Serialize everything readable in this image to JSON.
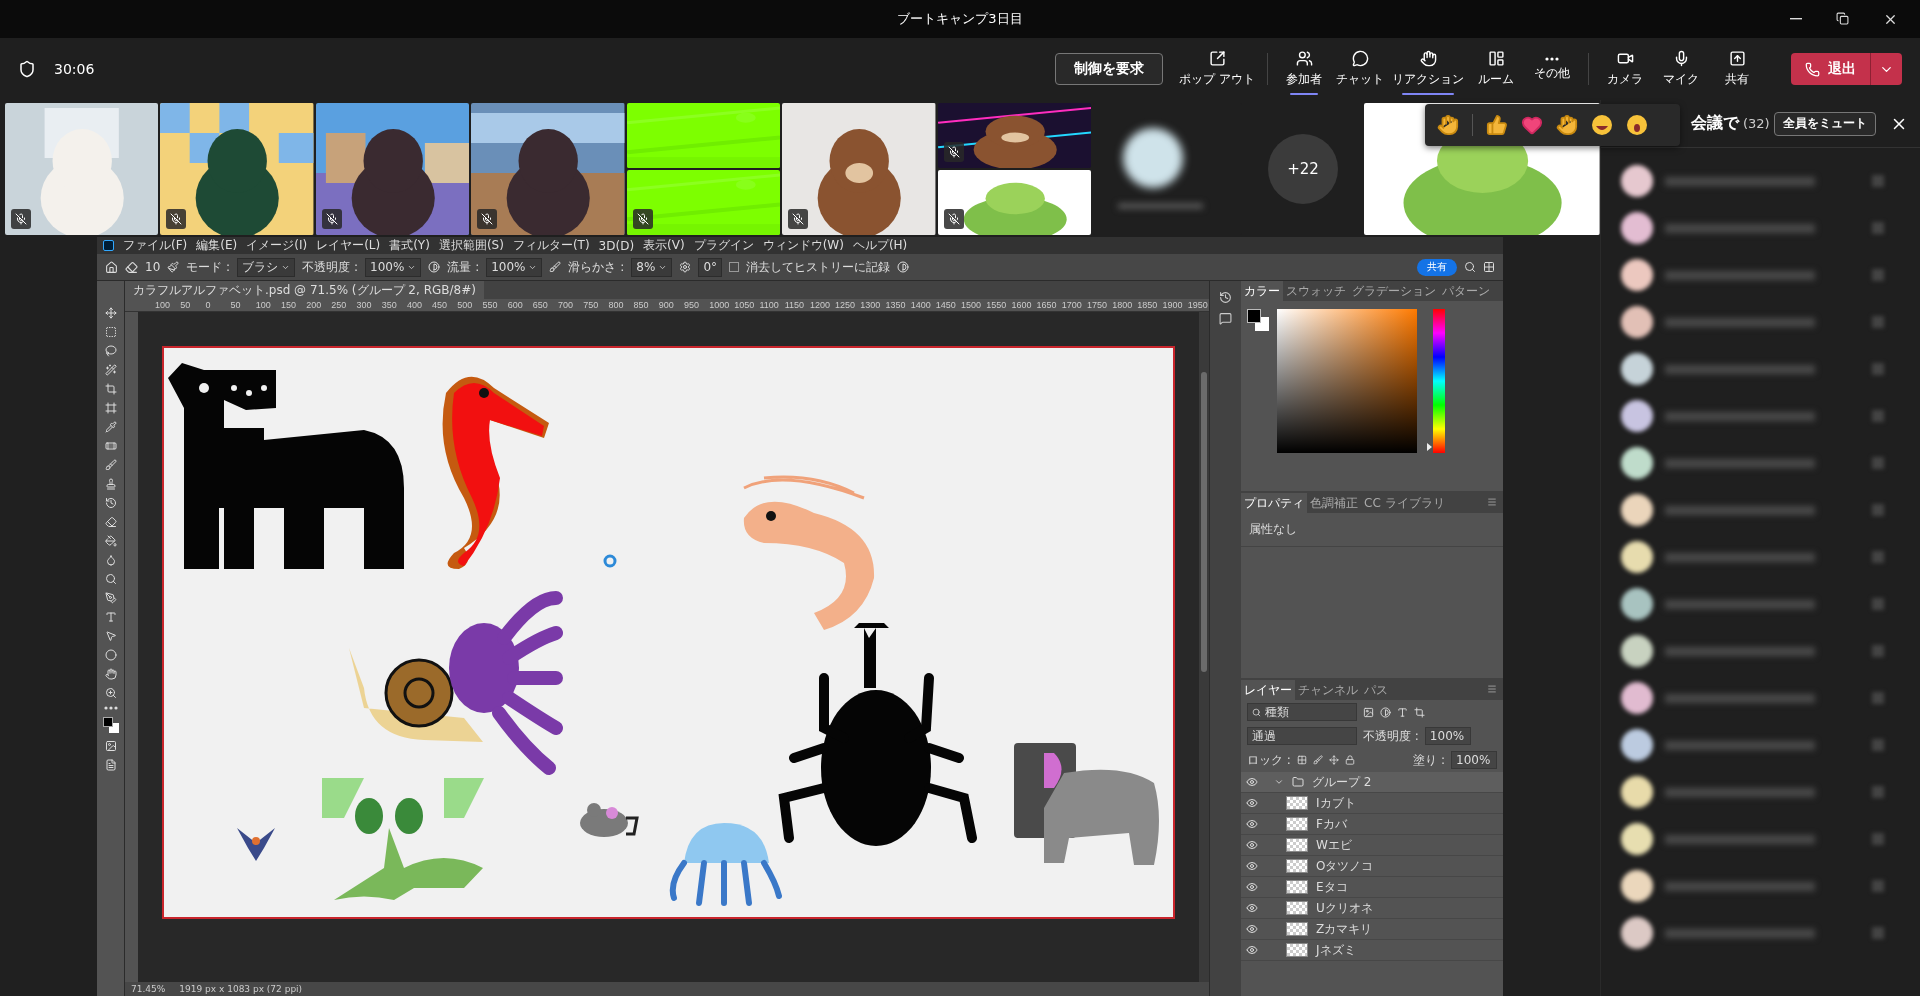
{
  "window": {
    "title": "ブートキャンプ3日目"
  },
  "toolbar": {
    "time": "30:06",
    "request_control": "制御を要求",
    "groups": [
      [
        {
          "label": "ポップ アウト",
          "selected": false
        }
      ],
      [
        {
          "label": "参加者",
          "selected": true
        },
        {
          "label": "チャット",
          "selected": false
        },
        {
          "label": "リアクション",
          "selected": true
        },
        {
          "label": "ルーム",
          "selected": false
        },
        {
          "label": "その他",
          "selected": false
        }
      ],
      [
        {
          "label": "カメラ",
          "selected": false
        },
        {
          "label": "マイク",
          "selected": false
        },
        {
          "label": "共有",
          "selected": false
        }
      ]
    ],
    "leave": "退出"
  },
  "tiles": [
    {
      "kind": "video",
      "panes": [
        {
          "kind": "picture",
          "muted": true
        }
      ]
    },
    {
      "kind": "video",
      "panes": [
        {
          "kind": "picture",
          "muted": true
        }
      ]
    },
    {
      "kind": "video",
      "panes": [
        {
          "kind": "picture",
          "muted": true
        }
      ]
    },
    {
      "kind": "video",
      "panes": [
        {
          "kind": "picture",
          "muted": true
        }
      ]
    },
    {
      "kind": "video",
      "panes": [
        {
          "kind": "picture",
          "muted": false
        },
        {
          "kind": "picture",
          "muted": true
        }
      ]
    },
    {
      "kind": "video",
      "panes": [
        {
          "kind": "picture",
          "muted": true
        }
      ]
    },
    {
      "kind": "video",
      "panes": [
        {
          "kind": "picture",
          "muted": true
        },
        {
          "kind": "picture",
          "muted": true
        }
      ]
    },
    {
      "kind": "avatar"
    },
    {
      "kind": "count",
      "label": "+22"
    },
    {
      "kind": "featured",
      "panes": [
        {
          "kind": "picture",
          "muted": false
        }
      ]
    }
  ],
  "participants": {
    "title": "会議で",
    "count": "(32)",
    "mute_all": "全員をミュート",
    "rows": [
      {
        "color": "#e6c8cf"
      },
      {
        "color": "#e3bdd2"
      },
      {
        "color": "#ecc8bf"
      },
      {
        "color": "#e2c0b6"
      },
      {
        "color": "#c6d3d9"
      },
      {
        "color": "#c8c4e1"
      },
      {
        "color": "#bfdccb"
      },
      {
        "color": "#ebd5bb"
      },
      {
        "color": "#e7dcae"
      },
      {
        "color": "#a8c3c0"
      },
      {
        "color": "#c8d2c0"
      },
      {
        "color": "#e1bbd0"
      },
      {
        "color": "#bccbe0"
      },
      {
        "color": "#e8dbaa"
      },
      {
        "color": "#e7deb0"
      },
      {
        "color": "#ebd7bc"
      },
      {
        "color": "#dcc9c5"
      }
    ]
  },
  "ps": {
    "menu": [
      "ファイル(F)",
      "編集(E)",
      "イメージ(I)",
      "レイヤー(L)",
      "書式(Y)",
      "選択範囲(S)",
      "フィルター(T)",
      "3D(D)",
      "表示(V)",
      "プラグイン",
      "ウィンドウ(W)",
      "ヘルプ(H)"
    ],
    "options": {
      "brush_size": "10",
      "mode_label": "モード :",
      "mode": "ブラシ",
      "opacity_label": "不透明度 :",
      "opacity": "100%",
      "flow_label": "流量 :",
      "flow": "100%",
      "smoothing_label": "滑らかさ :",
      "smoothing": "8%",
      "angle": "0°",
      "erase_history": {
        "label": "消去してヒストリーに記録",
        "checked": false
      },
      "share": "共有"
    },
    "document_tab": "カラフルアルファベット.psd @ 71.5% (グループ 2, RGB/8#)",
    "ruler": [
      "100",
      "50",
      "0",
      "50",
      "100",
      "150",
      "200",
      "250",
      "300",
      "350",
      "400",
      "450",
      "500",
      "550",
      "600",
      "650",
      "700",
      "750",
      "800",
      "850",
      "900",
      "950",
      "1000",
      "1050",
      "1100",
      "1150",
      "1200",
      "1250",
      "1300",
      "1350",
      "1400",
      "1450",
      "1500",
      "1550",
      "1600",
      "1650",
      "1700",
      "1750",
      "1800",
      "1850",
      "1900",
      "1950"
    ],
    "status": {
      "zoom": "71.45%",
      "size": "1919 px x 1083 px (72 ppi)"
    },
    "color_panel": {
      "hue_slider": {
        "level": 0.04
      },
      "tabs": [
        {
          "label": "カラー",
          "selected": true
        },
        {
          "label": "スウォッチ",
          "selected": false
        },
        {
          "label": "グラデーション",
          "selected": false
        },
        {
          "label": "パターン",
          "selected": false
        }
      ]
    },
    "properties_panel": {
      "tabs": [
        {
          "label": "プロパティ",
          "selected": true
        },
        {
          "label": "色調補正",
          "selected": false
        },
        {
          "label": "CC ライブラリ",
          "selected": false
        }
      ],
      "text": "属性なし"
    },
    "layers_panel": {
      "tabs": [
        {
          "label": "レイヤー",
          "selected": true
        },
        {
          "label": "チャンネル",
          "selected": false
        },
        {
          "label": "パス",
          "selected": false
        }
      ],
      "filter": "種類",
      "blend": "通過",
      "opacity_label": "不透明度 :",
      "opacity": "100%",
      "lock_label": "ロック :",
      "fill_label": "塗り :",
      "fill": "100%",
      "layers": [
        {
          "name": "グループ 2",
          "visible": true,
          "expanded": true,
          "children": [
            {
              "name": "Iカブト",
              "visible": true
            },
            {
              "name": "Fカバ",
              "visible": true
            },
            {
              "name": "Wエビ",
              "visible": true
            },
            {
              "name": "Oタツノコ",
              "visible": true
            },
            {
              "name": "Eタコ",
              "visible": true
            },
            {
              "name": "Uクリオネ",
              "visible": true
            },
            {
              "name": "Zカマキリ",
              "visible": true
            },
            {
              "name": "Jネズミ",
              "visible": true
            }
          ]
        }
      ]
    }
  }
}
